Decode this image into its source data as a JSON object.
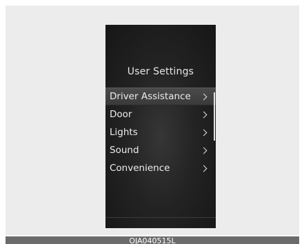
{
  "screen": {
    "title": "User Settings",
    "menu": [
      {
        "label": "Driver Assistance",
        "chevron": ">",
        "selected": true
      },
      {
        "label": "Door",
        "chevron": ">",
        "selected": false
      },
      {
        "label": "Lights",
        "chevron": ">",
        "selected": false
      },
      {
        "label": "Sound",
        "chevron": ">",
        "selected": false
      },
      {
        "label": "Convenience",
        "chevron": ">",
        "selected": false
      }
    ]
  },
  "caption": "OJA040515L"
}
